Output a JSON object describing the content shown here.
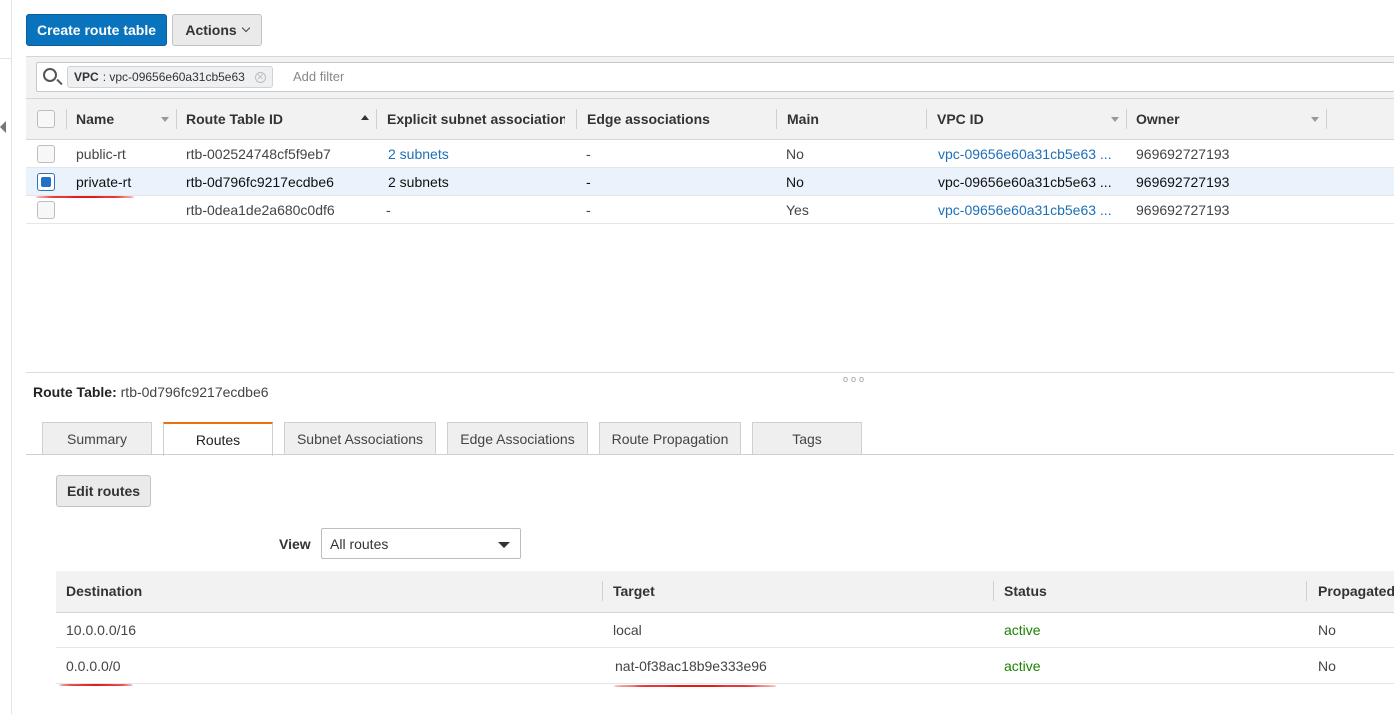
{
  "toolbar": {
    "create_label": "Create route table",
    "actions_label": "Actions"
  },
  "filter": {
    "token_key": "VPC",
    "token_value": ": vpc-09656e60a31cb5e63",
    "placeholder": "Add filter"
  },
  "table": {
    "columns": [
      "Name",
      "Route Table ID",
      "Explicit subnet association",
      "Edge associations",
      "Main",
      "VPC ID",
      "Owner"
    ],
    "rows": [
      {
        "name": "public-rt",
        "id": "rtb-002524748cf5f9eb7",
        "subnets": "2 subnets",
        "edge": "-",
        "main": "No",
        "vpc": "vpc-09656e60a31cb5e63 ...",
        "owner": "969692727193",
        "selected": false
      },
      {
        "name": "private-rt",
        "id": "rtb-0d796fc9217ecdbe6",
        "subnets": "2 subnets",
        "edge": "-",
        "main": "No",
        "vpc": "vpc-09656e60a31cb5e63 ...",
        "owner": "969692727193",
        "selected": true
      },
      {
        "name": "",
        "id": "rtb-0dea1de2a680c0df6",
        "subnets": "-",
        "edge": "-",
        "main": "Yes",
        "vpc": "vpc-09656e60a31cb5e63 ...",
        "owner": "969692727193",
        "selected": false
      }
    ]
  },
  "detail": {
    "title_label": "Route Table:",
    "title_value": "rtb-0d796fc9217ecdbe6",
    "tabs": [
      "Summary",
      "Routes",
      "Subnet Associations",
      "Edge Associations",
      "Route Propagation",
      "Tags"
    ],
    "active_tab": "Routes",
    "edit_label": "Edit routes",
    "view_label": "View",
    "view_value": "All routes",
    "route_columns": [
      "Destination",
      "Target",
      "Status",
      "Propagated"
    ],
    "routes": [
      {
        "destination": "10.0.0.0/16",
        "target": "local",
        "status": "active",
        "propagated": "No"
      },
      {
        "destination": "0.0.0.0/0",
        "target": "nat-0f38ac18b9e333e96",
        "status": "active",
        "propagated": "No"
      }
    ]
  },
  "colors": {
    "primary": "#0a73bd",
    "link": "#1f6fb6",
    "active_status": "#1d8102",
    "tab_accent": "#ec7211",
    "annotation": "#e01b1b",
    "selected_row": "#eaf3fc"
  }
}
